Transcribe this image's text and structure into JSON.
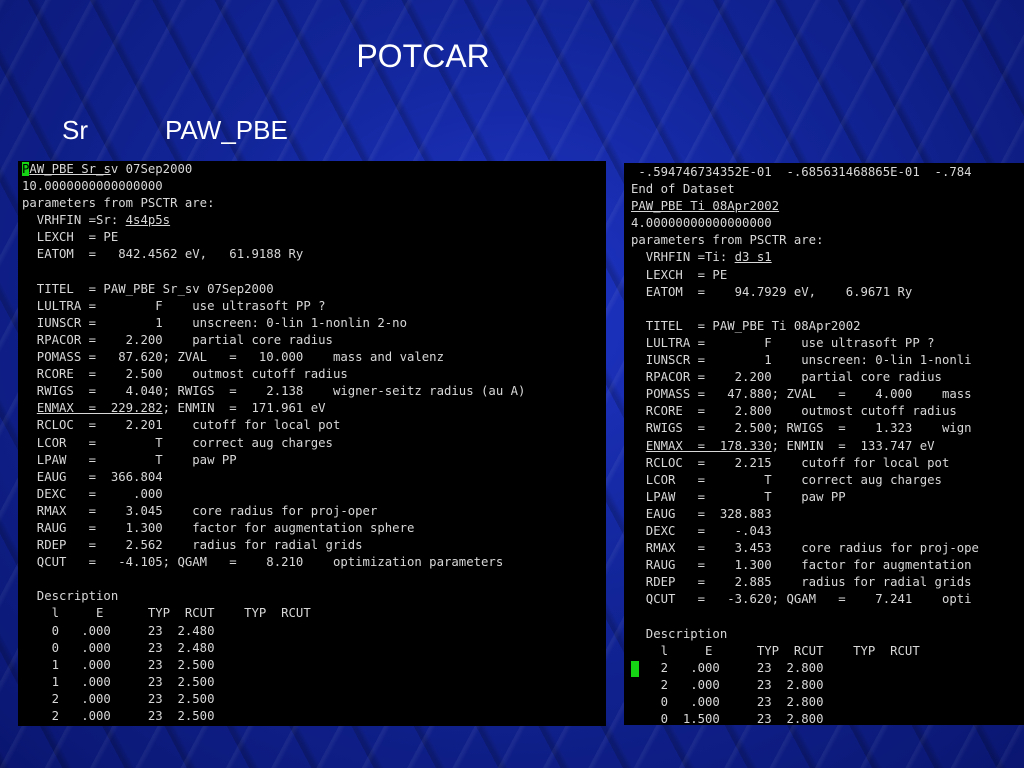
{
  "slide": {
    "title": "POTCAR",
    "element": "Sr",
    "functional": "PAW_PBE"
  },
  "colors": {
    "background": "#1224a0",
    "terminal_bg": "#000000",
    "terminal_text": "#d8d8d8",
    "cursor": "#14d414"
  },
  "left_terminal": {
    "lines": [
      "PAW_PBE Sr_sv 07Sep2000",
      "10.0000000000000000",
      "parameters from PSCTR are:",
      "  VRHFIN =Sr: 4s4p5s",
      "  LEXCH  = PE",
      "  EATOM  =   842.4562 eV,   61.9188 Ry",
      "",
      "  TITEL  = PAW_PBE Sr_sv 07Sep2000",
      "  LULTRA =        F    use ultrasoft PP ?",
      "  IUNSCR =        1    unscreen: 0-lin 1-nonlin 2-no",
      "  RPACOR =    2.200    partial core radius",
      "  POMASS =   87.620; ZVAL   =   10.000    mass and valenz",
      "  RCORE  =    2.500    outmost cutoff radius",
      "  RWIGS  =    4.040; RWIGS  =    2.138    wigner-seitz radius (au A)",
      "  ENMAX  =  229.282; ENMIN  =  171.961 eV",
      "  RCLOC  =    2.201    cutoff for local pot",
      "  LCOR   =        T    correct aug charges",
      "  LPAW   =        T    paw PP",
      "  EAUG   =  366.804",
      "  DEXC   =     .000",
      "  RMAX   =    3.045    core radius for proj-oper",
      "  RAUG   =    1.300    factor for augmentation sphere",
      "  RDEP   =    2.562    radius for radial grids",
      "  QCUT   =   -4.105; QGAM   =    8.210    optimization parameters",
      "",
      "  Description",
      "    l     E      TYP  RCUT    TYP  RCUT",
      "    0   .000     23  2.480",
      "    0   .000     23  2.480",
      "    1   .000     23  2.500",
      "    1   .000     23  2.500",
      "    2   .000     23  2.500",
      "    2   .000     23  2.500"
    ]
  },
  "right_terminal": {
    "lines": [
      " -.594746734352E-01  -.685631468865E-01  -.784",
      "End of Dataset",
      "PAW_PBE Ti 08Apr2002",
      "4.00000000000000000",
      "parameters from PSCTR are:",
      "  VRHFIN =Ti: d3 s1",
      "  LEXCH  = PE",
      "  EATOM  =    94.7929 eV,    6.9671 Ry",
      "",
      "  TITEL  = PAW_PBE Ti 08Apr2002",
      "  LULTRA =        F    use ultrasoft PP ?",
      "  IUNSCR =        1    unscreen: 0-lin 1-nonli",
      "  RPACOR =    2.200    partial core radius",
      "  POMASS =   47.880; ZVAL   =    4.000    mass",
      "  RCORE  =    2.800    outmost cutoff radius",
      "  RWIGS  =    2.500; RWIGS  =    1.323    wign",
      "  ENMAX  =  178.330; ENMIN  =  133.747 eV",
      "  RCLOC  =    2.215    cutoff for local pot",
      "  LCOR   =        T    correct aug charges",
      "  LPAW   =        T    paw PP",
      "  EAUG   =  328.883",
      "  DEXC   =    -.043",
      "  RMAX   =    3.453    core radius for proj-ope",
      "  RAUG   =    1.300    factor for augmentation",
      "  RDEP   =    2.885    radius for radial grids",
      "  QCUT   =   -3.620; QGAM   =    7.241    opti",
      "",
      "  Description",
      "    l     E      TYP  RCUT    TYP  RCUT",
      "    2   .000     23  2.800",
      "    2   .000     23  2.800",
      "    0   .000     23  2.800",
      "    0  1.500     23  2.800"
    ]
  }
}
